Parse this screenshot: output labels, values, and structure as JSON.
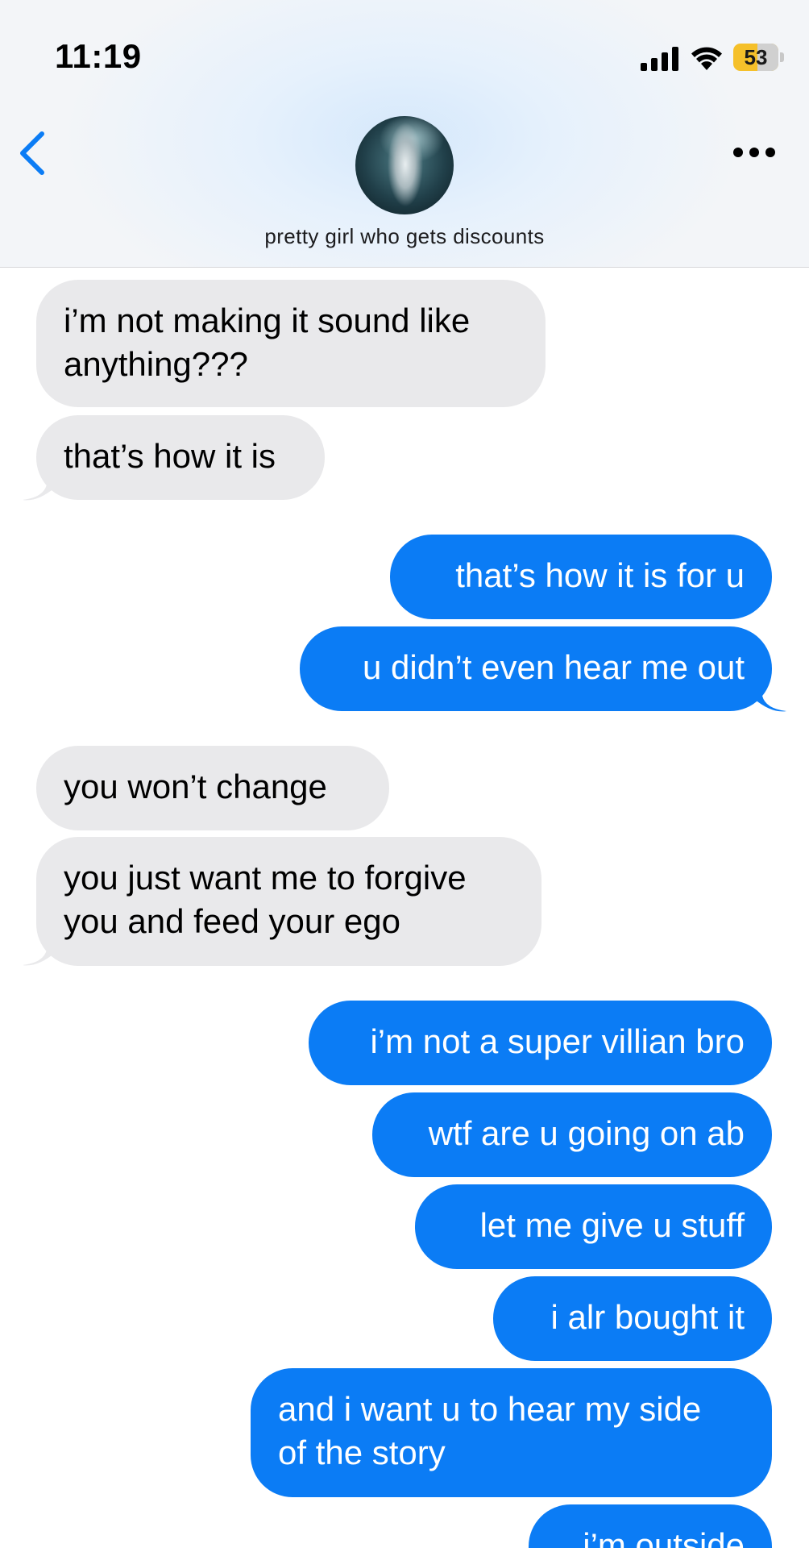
{
  "status_bar": {
    "time": "11:19",
    "battery_level": "53",
    "battery_color": "#f5c02a"
  },
  "header": {
    "contact_name": "pretty girl who gets discounts",
    "back_icon": "chevron-left-icon",
    "more_icon": "ellipsis-icon",
    "accent_color": "#0b7cf5"
  },
  "messages": [
    {
      "from": "them",
      "text": "i’m not making it sound like\nanything???"
    },
    {
      "from": "them",
      "text": "that’s how it is"
    },
    {
      "from": "me",
      "text": "that’s how it is for u"
    },
    {
      "from": "me",
      "text": "u didn’t even hear me out"
    },
    {
      "from": "them",
      "text": "you won’t change"
    },
    {
      "from": "them",
      "text": "you just want me to forgive\nyou and feed your ego"
    },
    {
      "from": "me",
      "text": "i’m not a super villian bro"
    },
    {
      "from": "me",
      "text": "wtf are u going on ab"
    },
    {
      "from": "me",
      "text": "let me give u stuff"
    },
    {
      "from": "me",
      "text": "i alr bought it"
    },
    {
      "from": "me",
      "text": "and i want u to hear my side\nof the story"
    },
    {
      "from": "me",
      "text": "i’m outside"
    }
  ],
  "colors": {
    "incoming_bubble": "#e9e9eb",
    "outgoing_bubble": "#0b7cf5"
  }
}
